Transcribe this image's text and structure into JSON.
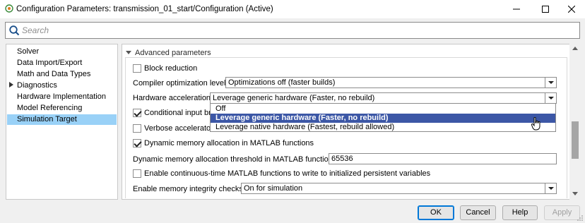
{
  "window": {
    "title": "Configuration Parameters: transmission_01_start/Configuration (Active)"
  },
  "search": {
    "placeholder": "Search"
  },
  "tree": {
    "items": [
      {
        "label": "Solver",
        "expandable": false,
        "selected": false
      },
      {
        "label": "Data Import/Export",
        "expandable": false,
        "selected": false
      },
      {
        "label": "Math and Data Types",
        "expandable": false,
        "selected": false
      },
      {
        "label": "Diagnostics",
        "expandable": true,
        "selected": false
      },
      {
        "label": "Hardware Implementation",
        "expandable": false,
        "selected": false
      },
      {
        "label": "Model Referencing",
        "expandable": false,
        "selected": false
      },
      {
        "label": "Simulation Target",
        "expandable": false,
        "selected": true
      }
    ]
  },
  "content": {
    "section_title": "Advanced parameters",
    "block_reduction": {
      "label": "Block reduction",
      "checked": false
    },
    "compiler_opt": {
      "label": "Compiler optimization level:",
      "value": "Optimizations off (faster builds)"
    },
    "hw_accel": {
      "label": "Hardware acceleration:",
      "value": "Leverage generic hardware (Faster, no rebuild)",
      "options": [
        "Off",
        "Leverage generic hardware (Faster, no rebuild)",
        "Leverage native hardware (Fastest, rebuild allowed)"
      ],
      "selected_index": 1
    },
    "conditional_input": {
      "label": "Conditional input bra",
      "checked": true
    },
    "verbose_accel": {
      "label": "Verbose accelerator",
      "checked": false
    },
    "dyn_mem_alloc": {
      "label": "Dynamic memory allocation in MATLAB functions",
      "checked": true
    },
    "dyn_mem_threshold": {
      "label": "Dynamic memory allocation threshold in MATLAB functions:",
      "value": "65536"
    },
    "continuous_time": {
      "label": "Enable continuous-time MATLAB functions to write to initialized persistent variables",
      "checked": false
    },
    "mem_integrity": {
      "label": "Enable memory integrity checks:",
      "value": "On for simulation"
    }
  },
  "buttons": {
    "ok": "OK",
    "cancel": "Cancel",
    "help": "Help",
    "apply": "Apply"
  },
  "colors": {
    "selection_blue": "#99d1f7",
    "dropdown_highlight": "#3c57a6",
    "primary_border": "#0078d7"
  }
}
